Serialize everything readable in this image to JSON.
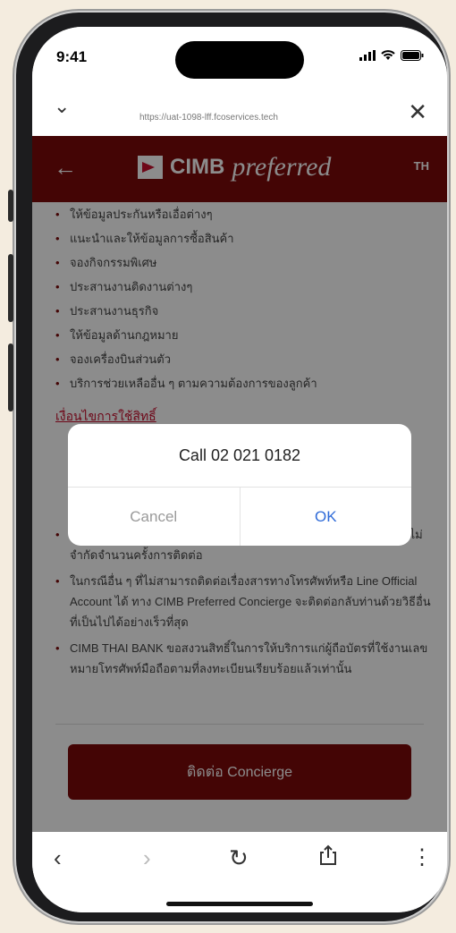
{
  "status_bar": {
    "time": "9:41"
  },
  "browser": {
    "url": "https://uat-1098-lff.fcoservices.tech"
  },
  "header": {
    "brand_name": "CIMB",
    "brand_tagline": "preferred",
    "language": "TH"
  },
  "content": {
    "services": [
      "ให้ข้อมูลประกันหรือเอื่อต่างๆ",
      "แนะนำและให้ข้อมูลการซื้อสินค้า",
      "จองกิจกรรมพิเศษ",
      "ประสานงานติดงานต่างๆ",
      "ประสานงานธุรกิจ",
      "ให้ข้อมูลด้านกฎหมาย",
      "จองเครื่องบินส่วนตัว",
      "บริการช่วยเหลืออื่น ๆ ตามความต้องการของลูกค้า"
    ],
    "conditions_title": "เงื่อนไขการใช้สิทธิ์",
    "conditions": [
      "Official Account: @CIMBTHAIWealth (ทุกวัน ตลอด 24 ชั่วโมง) โดยไม่จำกัดจำนวนครั้งการติดต่อ",
      "ในกรณีอื่น ๆ ที่ไม่สามารถติดต่อเรื่องสารทางโทรศัพท์หรือ Line Official Account ได้ ทาง CIMB Preferred Concierge จะติดต่อกลับท่านด้วยวิธีอื่นที่เป็นไปได้อย่างเร็วที่สุด",
      "CIMB THAI BANK ขอสงวนสิทธิ์ในการให้บริการแก่ผู้ถือบัตรที่ใช้งานเลขหมายโทรศัพท์มือถือตามที่ลงทะเบียนเรียบร้อยแล้วเท่านั้น"
    ],
    "cta_label": "ติดต่อ Concierge"
  },
  "dialog": {
    "title": "Call 02 021 0182",
    "cancel_label": "Cancel",
    "ok_label": "OK"
  },
  "toolbar": {
    "icons": [
      "back-icon",
      "forward-icon",
      "reload-icon",
      "share-icon",
      "more-icon"
    ]
  },
  "colors": {
    "brand_red": "#7d0a0a",
    "accent_red": "#c8102e",
    "link_blue": "#2f6bd8"
  }
}
